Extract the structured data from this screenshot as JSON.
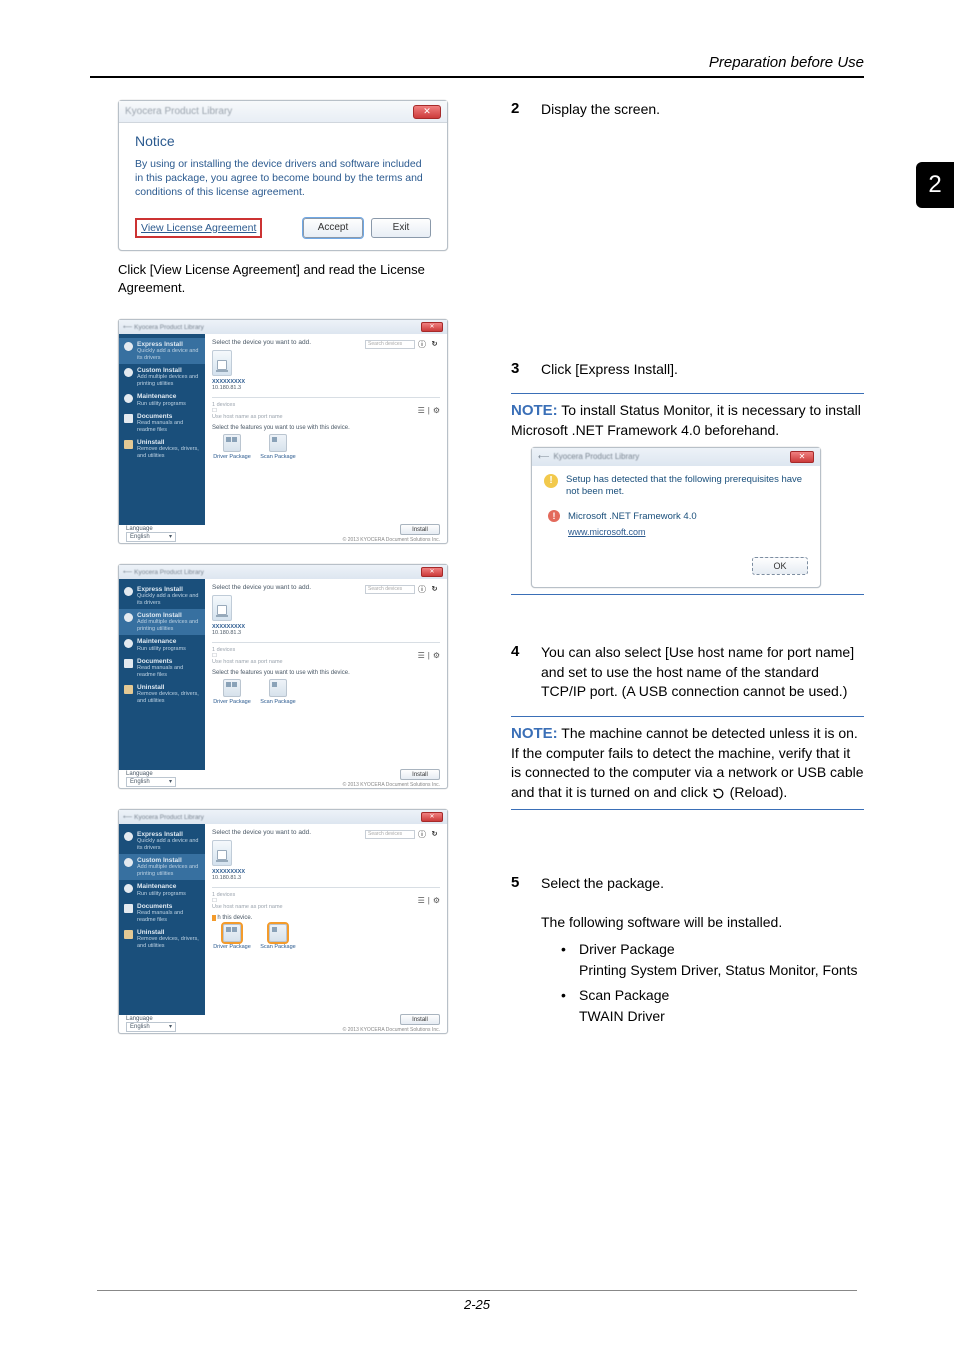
{
  "page": {
    "header": "Preparation before Use",
    "chapter": "2",
    "footer": "2-25"
  },
  "dialog1": {
    "title": "Kyocera Product Library",
    "close": "✕",
    "notice_heading": "Notice",
    "notice_text": "By using or installing the device drivers and software included in this package, you agree to become bound by the terms and conditions of this license agreement.",
    "link": "View License Agreement",
    "accept": "Accept",
    "exit": "Exit"
  },
  "caption_dialog1": "Click [View License Agreement] and read the License Agreement.",
  "plwin": {
    "back": "⟵ Kyocera Product Library",
    "close": "✕",
    "sidebar": {
      "express": {
        "title": "Express Install",
        "sub": "Quickly add a device and its drivers"
      },
      "custom": {
        "title": "Custom Install",
        "sub": "Add multiple devices and printing utilities"
      },
      "maint": {
        "title": "Maintenance",
        "sub": "Run utility programs"
      },
      "docs": {
        "title": "Documents",
        "sub": "Read manuals and readme files"
      },
      "uninst": {
        "title": "Uninstall",
        "sub": "Remove devices, drivers, and utilities"
      }
    },
    "main": {
      "select_device": "Select the device you want to add.",
      "search_placeholder": "Search devices",
      "dev_model_label": "XXXXXXXXX",
      "dev_ip": "10.180.81.3",
      "devices_count": "1 devices",
      "hostname_checkbox": "Use host name as port name",
      "features_label": "Select the features you want to use with this device.",
      "driver_pkg": "Driver Package",
      "scan_pkg": "Scan Package"
    },
    "footer": {
      "language_label": "Language",
      "language_value": "English",
      "install": "Install",
      "copyright": "© 2013 KYOCERA Document Solutions Inc."
    }
  },
  "steps": {
    "s2": {
      "num": "2",
      "text": "Display the screen."
    },
    "s3": {
      "num": "3",
      "text": "Click [Express Install]."
    },
    "s4": {
      "num": "4",
      "text": "You can also select [Use host name for port name] and set to use the host name of the standard TCP/IP port. (A USB connection cannot be used.)"
    },
    "s5": {
      "num": "5",
      "text": "Select the package."
    }
  },
  "note1": {
    "label": "NOTE:",
    "text": " To install Status Monitor, it is necessary to install Microsoft .NET Framework 4.0 beforehand."
  },
  "prereq": {
    "title": "Kyocera Product Library",
    "close": "✕",
    "message": "Setup has detected that the following prerequisites have not been met.",
    "item": "Microsoft .NET Framework 4.0",
    "link": "www.microsoft.com",
    "ok": "OK"
  },
  "note2": {
    "label": "NOTE:",
    "text_a": " The machine cannot be detected unless it is on. If the computer fails to detect the machine, verify that it is connected to the computer via a network or USB cable and that it is turned on and click ",
    "text_b": " (Reload)."
  },
  "packages": {
    "intro": "The following software will be installed.",
    "driver_title": "Driver Package",
    "driver_sub": "Printing System Driver, Status Monitor, Fonts",
    "scan_title": "Scan Package",
    "scan_sub": "TWAIN Driver"
  }
}
